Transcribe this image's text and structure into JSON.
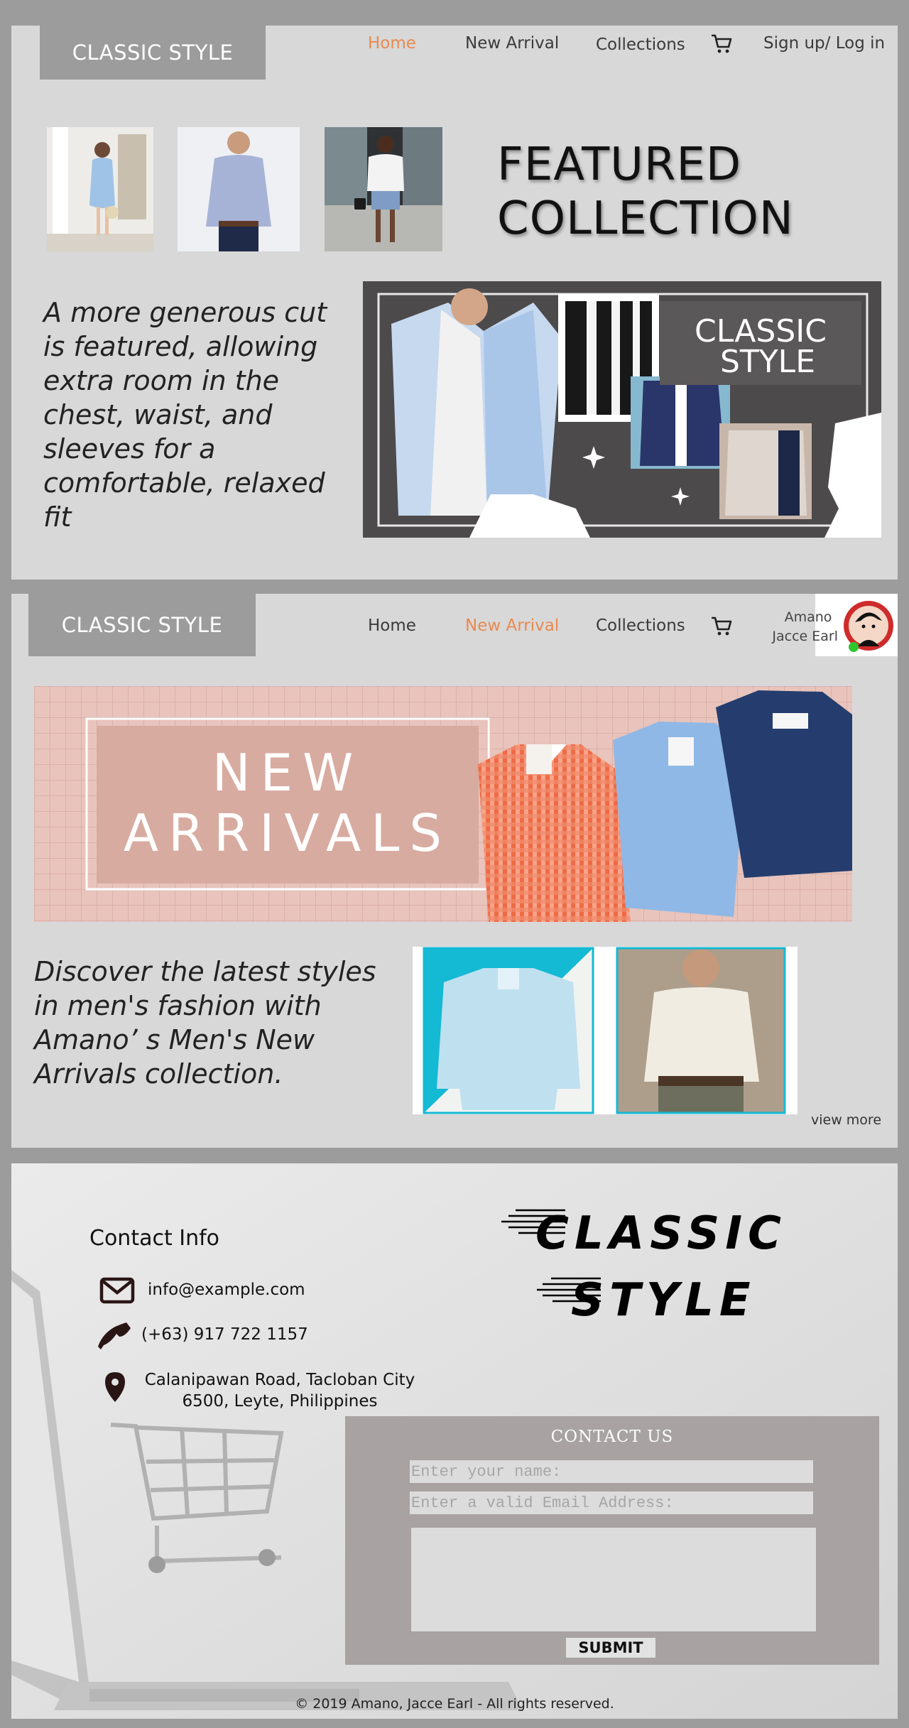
{
  "section1": {
    "brand": "CLASSIC STYLE",
    "nav": [
      {
        "label": "Home",
        "active": true
      },
      {
        "label": "New Arrival",
        "active": false
      },
      {
        "label": "Collections",
        "active": false
      }
    ],
    "auth_label": "Sign up/ Log in",
    "feature_title_line1": "FEATURED",
    "feature_title_line2": "COLLECTION",
    "blurb": "A more generous cut is featured, allowing extra room in the chest, waist, and sleeves for a comfortable, relaxed fit",
    "banner_brand_line1": "CLASSIC",
    "banner_brand_line2": "STYLE"
  },
  "section2": {
    "brand": "CLASSIC STYLE",
    "nav": [
      {
        "label": "Home",
        "active": false
      },
      {
        "label": "New Arrival",
        "active": true
      },
      {
        "label": "Collections",
        "active": false
      }
    ],
    "user_first": "Amano",
    "user_last": "Jacce Earl",
    "banner_line1": "NEW",
    "banner_line2": "ARRIVALS",
    "blurb": "Discover the latest styles in men's fashion with Amano’ s Men's New Arrivals collection.",
    "view_more": "view more"
  },
  "section3": {
    "contact_title": "Contact Info",
    "email": "info@example.com",
    "phone": "(+63) 917 722 1157",
    "address_line1": "Calanipawan Road, Tacloban City",
    "address_line2": "6500, Leyte, Philippines",
    "brand_line1": "CLASSIC",
    "brand_line2": "STYLE",
    "form_title": "CONTACT US",
    "name_placeholder": "Enter your name:",
    "email_placeholder": "Enter a valid Email Address:",
    "submit_label": "SUBMIT",
    "footer": "© 2019 Amano, Jacce Earl - All rights reserved."
  },
  "colors": {
    "frame": "#9c9c9c",
    "panel": "#d8d8d8",
    "accent": "#e98a4f",
    "form_bg": "#a8a2a2"
  }
}
